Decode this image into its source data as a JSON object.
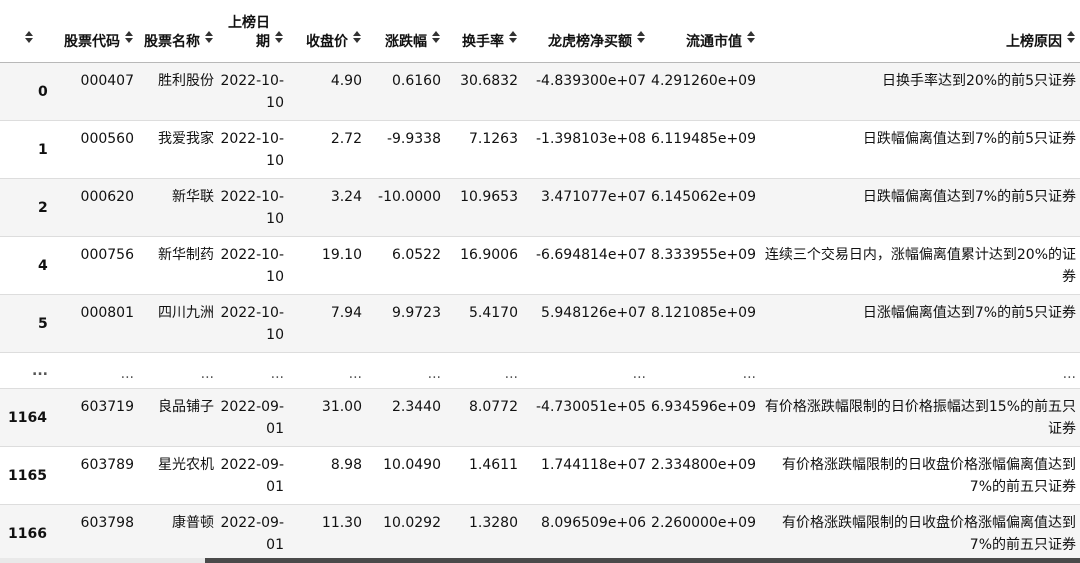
{
  "columns": [
    {
      "key": "idx",
      "label": ""
    },
    {
      "key": "code",
      "label": "股票代码"
    },
    {
      "key": "name",
      "label": "股票名称"
    },
    {
      "key": "date",
      "label": "上榜日期"
    },
    {
      "key": "close",
      "label": "收盘价"
    },
    {
      "key": "change",
      "label": "涨跌幅"
    },
    {
      "key": "turnover",
      "label": "换手率"
    },
    {
      "key": "net_buy",
      "label": "龙虎榜净买额"
    },
    {
      "key": "float_cap",
      "label": "流通市值"
    },
    {
      "key": "reason",
      "label": "上榜原因"
    }
  ],
  "rows": [
    {
      "idx": "0",
      "code": "000407",
      "name": "胜利股份",
      "date": "2022-10-10",
      "close": "4.90",
      "change": "0.6160",
      "turnover": "30.6832",
      "net_buy": "-4.839300e+07",
      "float_cap": "4.291260e+09",
      "reason": "日换手率达到20%的前5只证券"
    },
    {
      "idx": "1",
      "code": "000560",
      "name": "我爱我家",
      "date": "2022-10-10",
      "close": "2.72",
      "change": "-9.9338",
      "turnover": "7.1263",
      "net_buy": "-1.398103e+08",
      "float_cap": "6.119485e+09",
      "reason": "日跌幅偏离值达到7%的前5只证券"
    },
    {
      "idx": "2",
      "code": "000620",
      "name": "新华联",
      "date": "2022-10-10",
      "close": "3.24",
      "change": "-10.0000",
      "turnover": "10.9653",
      "net_buy": "3.471077e+07",
      "float_cap": "6.145062e+09",
      "reason": "日跌幅偏离值达到7%的前5只证券"
    },
    {
      "idx": "4",
      "code": "000756",
      "name": "新华制药",
      "date": "2022-10-10",
      "close": "19.10",
      "change": "6.0522",
      "turnover": "16.9006",
      "net_buy": "-6.694814e+07",
      "float_cap": "8.333955e+09",
      "reason": "连续三个交易日内，涨幅偏离值累计达到20%的证券"
    },
    {
      "idx": "5",
      "code": "000801",
      "name": "四川九洲",
      "date": "2022-10-10",
      "close": "7.94",
      "change": "9.9723",
      "turnover": "5.4170",
      "net_buy": "5.948126e+07",
      "float_cap": "8.121085e+09",
      "reason": "日涨幅偏离值达到7%的前5只证券"
    }
  ],
  "ellipsis": "...",
  "tail_rows": [
    {
      "idx": "1164",
      "code": "603719",
      "name": "良品铺子",
      "date": "2022-09-01",
      "close": "31.00",
      "change": "2.3440",
      "turnover": "8.0772",
      "net_buy": "-4.730051e+05",
      "float_cap": "6.934596e+09",
      "reason": "有价格涨跌幅限制的日价格振幅达到15%的前五只证券"
    },
    {
      "idx": "1165",
      "code": "603789",
      "name": "星光农机",
      "date": "2022-09-01",
      "close": "8.98",
      "change": "10.0490",
      "turnover": "1.4611",
      "net_buy": "1.744118e+07",
      "float_cap": "2.334800e+09",
      "reason": "有价格涨跌幅限制的日收盘价格涨幅偏离值达到7%的前五只证券"
    },
    {
      "idx": "1166",
      "code": "603798",
      "name": "康普顿",
      "date": "2022-09-01",
      "close": "11.30",
      "change": "10.0292",
      "turnover": "1.3280",
      "net_buy": "8.096509e+06",
      "float_cap": "2.260000e+09",
      "reason": "有价格涨跌幅限制的日收盘价格涨幅偏离值达到7%的前五只证券"
    }
  ],
  "icons": {
    "sort": "sort-updown-icon"
  },
  "colors": {
    "alt_row": "#f5f5f5",
    "border": "#dddddd",
    "scroll_thumb": "#4a4a4a"
  }
}
